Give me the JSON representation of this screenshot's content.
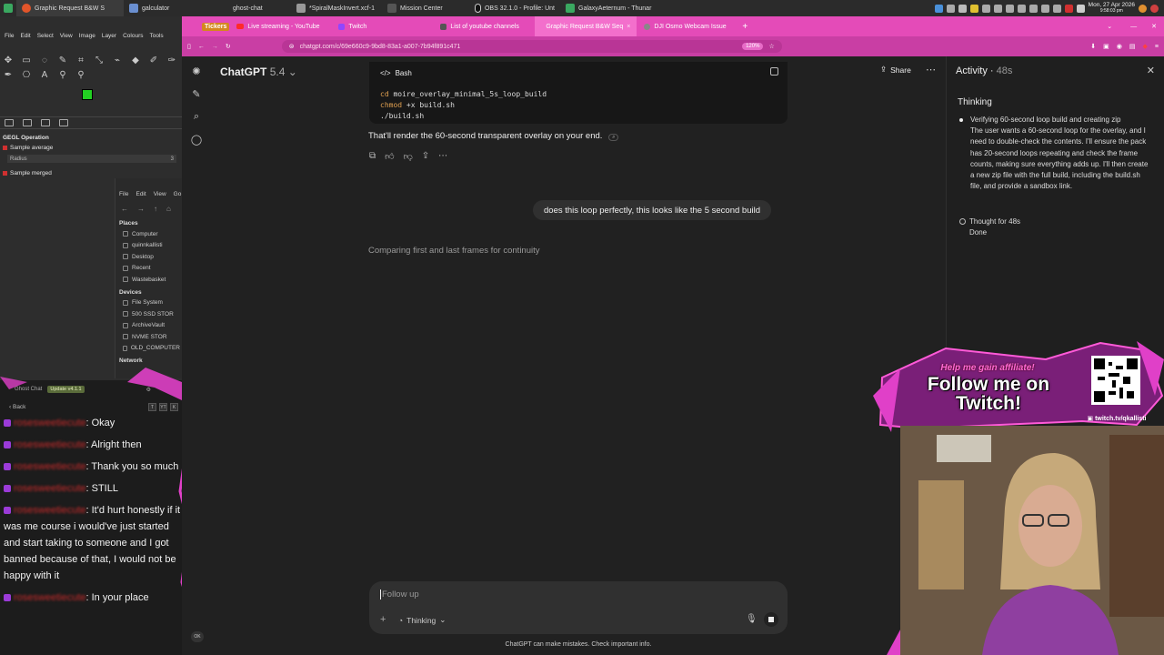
{
  "taskbar": {
    "items": [
      {
        "label": "Graphic Request B&W S",
        "color": "#e2552a"
      },
      {
        "label": "galculator",
        "color": "#6a8fd0"
      },
      {
        "label": "ghost-chat",
        "color": "#888888"
      },
      {
        "label": "*SpiralMaskInvert.xcf-1",
        "color": "#999999"
      },
      {
        "label": "Mission Center",
        "color": "#555555"
      },
      {
        "label": "OBS 32.1.0 - Profile: Unt",
        "color": "#333333"
      },
      {
        "label": "GalaxyAeternum - Thunar",
        "color": "#3aa860"
      }
    ],
    "clock_line1": "Mon, 27 Apr 2026",
    "clock_line2": "9:58:03 pm"
  },
  "gimp": {
    "menu": [
      "File",
      "Edit",
      "Select",
      "View",
      "Image",
      "Layer",
      "Colours",
      "Tools"
    ],
    "gegl_title": "GEGL Operation",
    "sample_average": "Sample average",
    "radius_label": "Radius",
    "radius_value": "3",
    "sample_merged": "Sample merged"
  },
  "thunar": {
    "menu": [
      "File",
      "Edit",
      "View",
      "Go"
    ],
    "places_title": "Places",
    "places": [
      "Computer",
      "quinnkallisti",
      "Desktop",
      "Recent",
      "Wastebasket"
    ],
    "devices_title": "Devices",
    "devices": [
      "File System",
      "500 SSD STOR",
      "ArchiveVault",
      "NVME STOR",
      "OLD_COMPUTER"
    ],
    "network_title": "Network"
  },
  "chat": {
    "app_title": "Ghost Chat",
    "update_badge": "Update v4.1.1",
    "back_label": "Back",
    "buttons": [
      "T",
      "YT",
      "K"
    ],
    "username": "rosesweetiecute",
    "messages": [
      "Okay",
      "Alright then",
      "Thank you so much",
      "STILL",
      "It'd hurt honestly if it was me course i would've just started and start taking to someone and I got banned because of that, I would not be happy with it",
      "In your place"
    ],
    "ok_label": "OK"
  },
  "browser": {
    "tabs": [
      {
        "label": "Live streaming - YouTube",
        "color": "#ff2a2a"
      },
      {
        "label": "Twitch",
        "color": "#9146ff"
      },
      {
        "label": "List of youtube channels",
        "color": "#555555"
      },
      {
        "label": "Graphic Request B&W Seq",
        "color": "#888888"
      },
      {
        "label": "DJI Osmo Webcam Issue",
        "color": "#888888"
      }
    ],
    "ticker_label": "Tickers",
    "url": "chatgpt.com/c/69e660c9-9bd8-83a1-a007-7b94f891c471",
    "zoom": "120%"
  },
  "chatgpt": {
    "title": "ChatGPT",
    "version": "5.4",
    "share_label": "Share",
    "code_lang": "Bash",
    "code_lines": [
      {
        "kw": "cd",
        "rest": " moire_overlay_minimal_5s_loop_build"
      },
      {
        "kw": "chmod",
        "rest": " +x build.sh"
      },
      {
        "kw": "",
        "rest": "./build.sh"
      }
    ],
    "reply_text": "That'll render the 60-second transparent overlay on your end.",
    "user_message": "does this loop perfectly, this looks like the 5 second build",
    "thinking_status": "Comparing first and last frames for continuity",
    "composer_placeholder": "Follow up",
    "mode_label": "Thinking",
    "disclaimer": "ChatGPT can make mistakes. Check important info."
  },
  "activity": {
    "title": "Activity",
    "elapsed": "48s",
    "section": "Thinking",
    "heading": "Verifying 60-second loop build and creating zip",
    "body": "The user wants a 60-second loop for the overlay, and I need to double-check the contents. I'll ensure the pack has 20-second loops repeating and check the frame counts, making sure everything adds up. I'll then create a new zip file with the full build, including the build.sh file, and provide a sandbox link.",
    "thought_for": "Thought for 48s",
    "done": "Done"
  },
  "stream_overlay": {
    "help_text": "Help me gain affiliate!",
    "follow_text": "Follow me on Twitch!",
    "twitch_url": "twitch.tv/qkallisti",
    "accent": "#e040c8"
  }
}
